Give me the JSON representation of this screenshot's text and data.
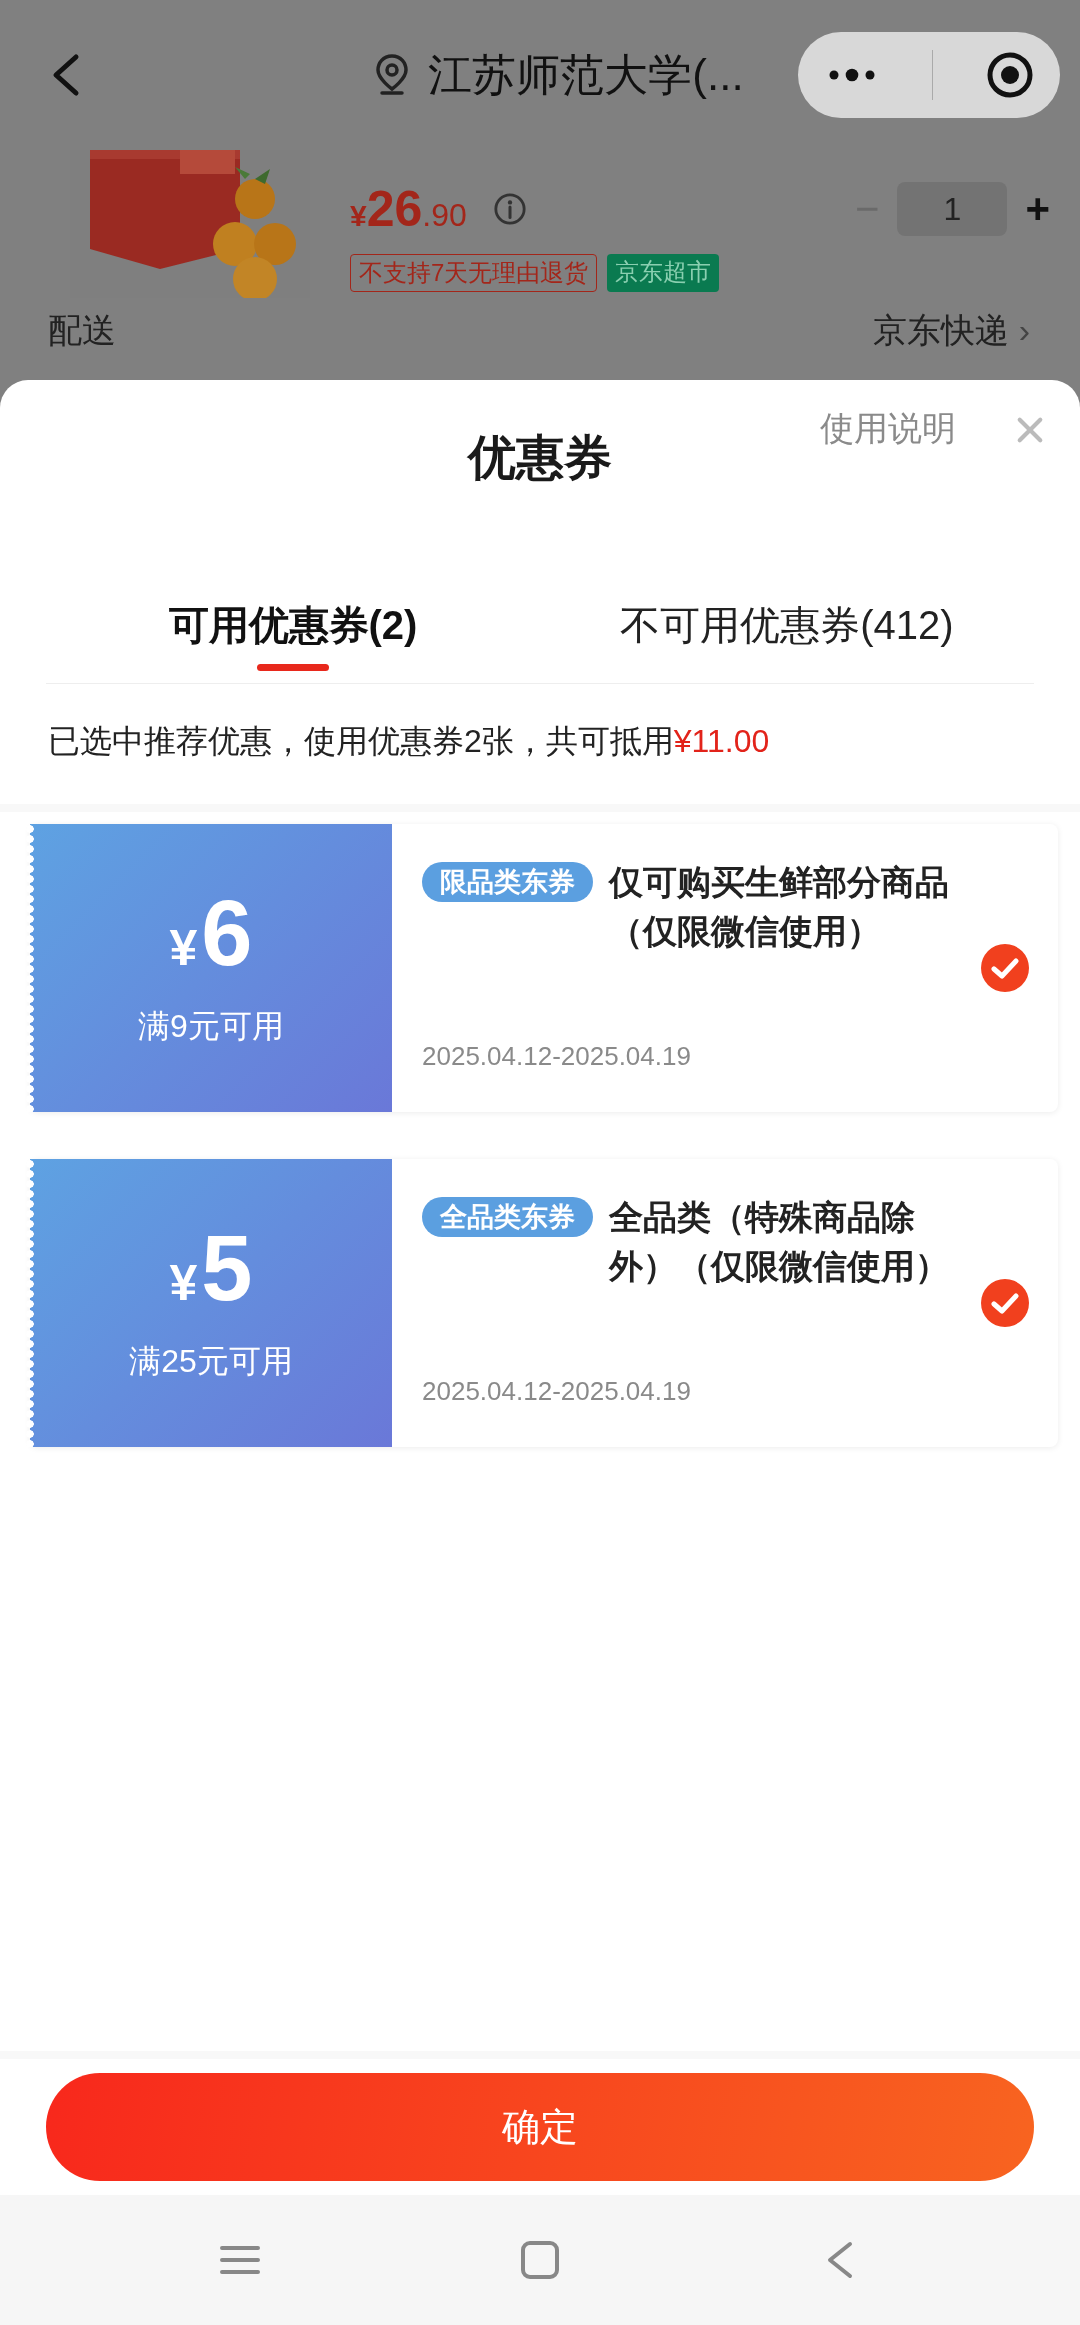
{
  "nav": {
    "title": "江苏师范大学(..."
  },
  "product": {
    "price_symbol": "¥",
    "price_int": "26",
    "price_dec": ".90",
    "minus": "−",
    "quantity": "1",
    "plus": "+",
    "tags": [
      {
        "text": "不支持7天无理由退货",
        "kind": "outline"
      },
      {
        "text": "京东超市",
        "kind": "filled"
      }
    ]
  },
  "delivery": {
    "label": "配送",
    "value": "京东快递",
    "chevron": "›"
  },
  "sheet": {
    "title": "优惠券",
    "help": "使用说明",
    "tabs": [
      {
        "label": "可用优惠券(2)",
        "selected": true
      },
      {
        "label": "不可用优惠券(412)",
        "selected": false
      }
    ],
    "summary": "已选中推荐优惠，使用优惠券2张，共可抵用**¥11.00**"
  },
  "coupons": [
    {
      "symbol": "¥",
      "amount": "6",
      "condition": "满9元可用",
      "tag": "限品类东券",
      "description": "仅可购买生鲜部分商品（仅限微信使用）",
      "validity": "2025.04.12-2025.04.19",
      "selected": true
    },
    {
      "symbol": "¥",
      "amount": "5",
      "condition": "满25元可用",
      "tag": "全品类东券",
      "description": "全品类（特殊商品除外）（仅限微信使用）",
      "validity": "2025.04.12-2025.04.19",
      "selected": true
    }
  ],
  "confirm": "确定"
}
